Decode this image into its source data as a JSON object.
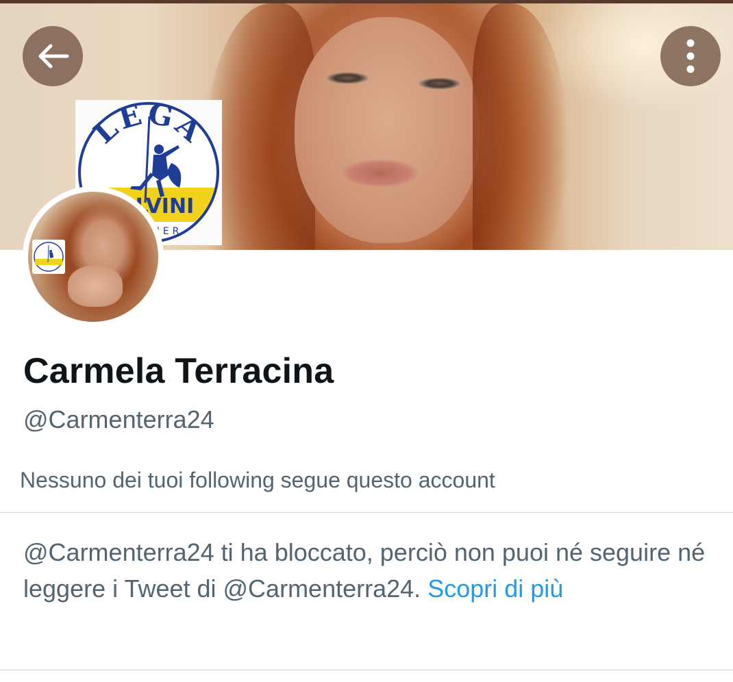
{
  "header": {
    "back_icon": "arrow-left-icon",
    "more_icon": "more-vertical-icon",
    "banner_badge": {
      "logo_text": "LEGA",
      "party_name": "SALVINI",
      "subtitle": "PREMIER"
    }
  },
  "profile": {
    "display_name": "Carmela Terracina",
    "handle": "@Carmenterra24",
    "followers_you_know": "Nessuno dei tuoi following segue questo account"
  },
  "blocked": {
    "message": "@Carmenterra24 ti ha bloccato, perciò non puoi né seguire né leggere i Tweet di @Carmenterra24.",
    "link_label": "Scopri di più"
  },
  "colors": {
    "name_text": "#0f1419",
    "secondary_text": "#536471",
    "link": "#1d9bf0",
    "divider": "#cfd9de",
    "lega_blue": "#1f3c97",
    "lega_yellow": "#f2d21b"
  }
}
